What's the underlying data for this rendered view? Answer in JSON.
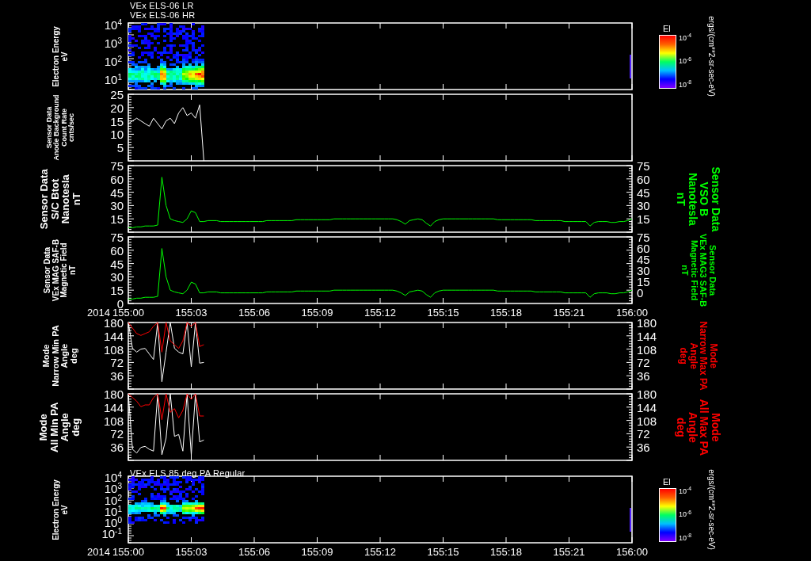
{
  "titles": [
    "VEx ELS-06 LR",
    "VEx ELS-06 HR"
  ],
  "panels": [
    {
      "kind": "spectrogram",
      "left_label": [
        "Electron Energy",
        "eV"
      ],
      "yticks": [
        "10$^{4}$",
        "10$^{3}$",
        "10$^{2}$",
        "10$^{1}$"
      ],
      "colorbar": {
        "label": "El",
        "ticks": [
          "10$^{-4}$",
          "10$^{-6}$",
          "10$^{-8}$"
        ],
        "units": "ergs/(cm**2-sr-sec-eV)"
      }
    },
    {
      "kind": "line",
      "left_label": [
        "Sensor Data",
        "Anode Background",
        "Count Rate",
        "cnts/sec"
      ],
      "chart_data": {
        "type": "line",
        "categories": [
          null,
          null,
          null,
          null,
          null,
          null,
          null,
          null,
          null,
          null,
          null,
          null,
          null,
          null,
          null,
          null,
          null,
          null,
          null
        ],
        "series": [
          {
            "color": "#ffffff",
            "values": [
              14,
              15,
              16,
              15,
              14,
              13,
              16,
              14,
              12,
              15,
              16,
              14,
              18,
              20,
              17,
              18,
              16,
              21,
              0
            ]
          }
        ],
        "ylim": [
          0,
          25
        ],
        "yticks": [
          {
            "value": 5,
            "label": "5"
          },
          {
            "value": 10,
            "label": "10"
          },
          {
            "value": 15,
            "label": "15"
          },
          {
            "value": 20,
            "label": "20"
          },
          {
            "value": 25,
            "label": "25"
          }
        ]
      }
    },
    {
      "kind": "line",
      "left_label": [
        "Sensor Data",
        "S/C Btot",
        "Nanotesla",
        "nT"
      ],
      "right_label": {
        "lines": [
          "Sensor Data",
          "VSO B",
          "Nanotesla",
          "nT"
        ],
        "color": "#00ff00"
      },
      "right_yticks": [
        "75",
        "60",
        "45",
        "30",
        "15"
      ],
      "chart_data": {
        "type": "line",
        "categories": [
          null,
          null,
          null,
          null,
          null,
          null,
          null,
          null,
          null,
          null,
          null,
          null,
          null,
          null,
          null,
          null,
          null,
          null,
          null,
          null,
          null,
          null,
          null,
          null,
          null,
          null,
          null,
          null,
          null,
          null,
          null,
          null,
          null,
          null,
          null,
          null,
          null,
          null,
          null,
          null,
          null,
          null,
          null,
          null,
          null,
          null,
          null,
          null,
          null,
          null,
          null,
          null,
          null,
          null,
          null,
          null,
          null,
          null,
          null,
          null,
          null,
          null,
          null,
          null,
          null,
          null,
          null,
          null,
          null,
          null,
          null,
          null,
          null,
          null,
          null,
          null,
          null,
          null,
          null,
          null,
          null,
          null,
          null,
          null,
          null,
          null,
          null,
          null,
          null,
          null,
          null,
          null,
          null,
          null,
          null,
          null,
          null,
          null,
          null,
          null,
          null,
          null,
          null,
          null,
          null,
          null,
          null,
          null,
          null,
          null,
          null,
          null,
          null,
          null,
          null,
          null,
          null,
          null,
          null,
          null,
          null
        ],
        "series": [
          {
            "color": "#00ff00",
            "values": [
              5,
              5,
              6,
              6,
              7,
              7,
              7,
              8,
              62,
              30,
              15,
              13,
              12,
              11,
              15,
              24,
              22,
              12,
              12,
              13,
              13,
              13,
              12,
              12,
              12,
              12,
              12,
              12,
              12,
              12,
              12,
              12,
              12,
              13,
              13,
              13,
              13,
              13,
              13,
              13,
              14,
              14,
              14,
              14,
              14,
              14,
              14,
              14,
              14,
              15,
              15,
              15,
              15,
              15,
              15,
              15,
              15,
              15,
              15,
              15,
              15,
              15,
              15,
              15,
              14,
              12,
              9,
              13,
              14,
              15,
              14,
              10,
              7,
              12,
              14,
              15,
              15,
              15,
              15,
              15,
              15,
              15,
              15,
              15,
              15,
              15,
              15,
              15,
              14,
              14,
              14,
              14,
              14,
              14,
              14,
              14,
              14,
              13,
              13,
              13,
              13,
              13,
              13,
              13,
              12,
              12,
              12,
              12,
              12,
              12,
              7,
              11,
              12,
              12,
              12,
              11,
              11,
              12,
              12,
              13,
              15
            ]
          }
        ],
        "ylim": [
          0,
          75
        ],
        "yticks": [
          {
            "value": 15,
            "label": "15"
          },
          {
            "value": 30,
            "label": "30"
          },
          {
            "value": 45,
            "label": "45"
          },
          {
            "value": 60,
            "label": "60"
          },
          {
            "value": 75,
            "label": "75"
          }
        ]
      }
    },
    {
      "kind": "line",
      "left_label": [
        "Sensor Data",
        "VEx MAG SAF-B",
        "Magnetic Field",
        "nT"
      ],
      "right_label": {
        "lines": [
          "Sensor Data",
          "VEx MAG3 SAF-B",
          "Magnetic Field",
          "nT"
        ],
        "color": "#00ff00"
      },
      "right_yticks": [
        "75",
        "60",
        "45",
        "30",
        "15",
        "0"
      ],
      "year": "2014",
      "chart_data": {
        "type": "line",
        "categories": [
          "155:00",
          null,
          null,
          null,
          null,
          null,
          null,
          null,
          null,
          null,
          null,
          null,
          null,
          null,
          null,
          "155:03",
          null,
          null,
          null,
          null,
          null,
          null,
          null,
          null,
          null,
          null,
          null,
          null,
          null,
          null,
          "155:06",
          null,
          null,
          null,
          null,
          null,
          null,
          null,
          null,
          null,
          null,
          null,
          null,
          null,
          null,
          "155:09",
          null,
          null,
          null,
          null,
          null,
          null,
          null,
          null,
          null,
          null,
          null,
          null,
          null,
          null,
          "155:12",
          null,
          null,
          null,
          null,
          null,
          null,
          null,
          null,
          null,
          null,
          null,
          null,
          null,
          null,
          "155:15",
          null,
          null,
          null,
          null,
          null,
          null,
          null,
          null,
          null,
          null,
          null,
          null,
          null,
          null,
          "155:18",
          null,
          null,
          null,
          null,
          null,
          null,
          null,
          null,
          null,
          null,
          null,
          null,
          null,
          null,
          "155:21",
          null,
          null,
          null,
          null,
          null,
          null,
          null,
          null,
          null,
          null,
          null,
          null,
          null,
          null,
          "156:00"
        ],
        "series": [
          {
            "color": "#00ff00",
            "values": [
              5,
              5,
              6,
              6,
              7,
              7,
              7,
              8,
              62,
              30,
              15,
              13,
              12,
              11,
              15,
              24,
              22,
              12,
              12,
              13,
              13,
              13,
              12,
              12,
              12,
              12,
              12,
              12,
              12,
              12,
              12,
              12,
              12,
              13,
              13,
              13,
              13,
              13,
              13,
              13,
              14,
              14,
              14,
              14,
              14,
              14,
              14,
              14,
              14,
              15,
              15,
              15,
              15,
              15,
              15,
              15,
              15,
              15,
              15,
              15,
              15,
              15,
              15,
              15,
              14,
              12,
              9,
              13,
              14,
              15,
              14,
              10,
              7,
              12,
              14,
              15,
              15,
              15,
              15,
              15,
              15,
              15,
              15,
              15,
              15,
              15,
              15,
              15,
              14,
              14,
              14,
              14,
              14,
              14,
              14,
              14,
              14,
              13,
              13,
              13,
              13,
              13,
              13,
              13,
              12,
              12,
              12,
              12,
              12,
              12,
              7,
              11,
              12,
              12,
              12,
              11,
              11,
              12,
              12,
              13,
              15
            ]
          }
        ],
        "ylim": [
          0,
          75
        ],
        "yticks": [
          {
            "value": 0,
            "label": "0"
          },
          {
            "value": 15,
            "label": "15"
          },
          {
            "value": 30,
            "label": "30"
          },
          {
            "value": 45,
            "label": "45"
          },
          {
            "value": 60,
            "label": "60"
          },
          {
            "value": 75,
            "label": "75"
          }
        ]
      }
    },
    {
      "kind": "line",
      "left_label": [
        "Mode",
        "Narrow Min PA",
        "Angle",
        "deg"
      ],
      "right_label": {
        "lines": [
          "Mode",
          "Narrow Max PA",
          "Angle",
          "deg"
        ],
        "color": "#ff0000"
      },
      "right_yticks": [
        "180",
        "144",
        "108",
        "72",
        "36"
      ],
      "chart_data": {
        "type": "line",
        "categories": [
          null,
          null,
          null,
          null,
          null,
          null,
          null,
          null,
          null,
          null,
          null,
          null,
          null,
          null,
          null,
          null,
          null,
          null,
          null
        ],
        "series": [
          {
            "color": "#ffffff",
            "values": [
              180,
              110,
              100,
              108,
              110,
              95,
              80,
              180,
              20,
              100,
              180,
              110,
              100,
              95,
              180,
              60,
              180,
              70,
              72
            ]
          },
          {
            "color": "#ff0000",
            "values": [
              180,
              165,
              150,
              145,
              150,
              155,
              170,
              180,
              100,
              180,
              130,
              120,
              110,
              130,
              180,
              170,
              180,
              115,
              120
            ]
          }
        ],
        "ylim": [
          0,
          180
        ],
        "yticks": [
          {
            "value": 36,
            "label": "36"
          },
          {
            "value": 72,
            "label": "72"
          },
          {
            "value": 108,
            "label": "108"
          },
          {
            "value": 144,
            "label": "144"
          },
          {
            "value": 180,
            "label": "180"
          }
        ]
      }
    },
    {
      "kind": "line",
      "left_label": [
        "Mode",
        "All Min PA",
        "Angle",
        "deg"
      ],
      "right_label": {
        "lines": [
          "Mode",
          "All Max PA",
          "Angle",
          "deg"
        ],
        "color": "#ff0000"
      },
      "right_yticks": [
        "180",
        "144",
        "108",
        "72",
        "36"
      ],
      "chart_data": {
        "type": "line",
        "categories": [
          null,
          null,
          null,
          null,
          null,
          null,
          null,
          null,
          null,
          null,
          null,
          null,
          null,
          null,
          null,
          null,
          null,
          null,
          null
        ],
        "series": [
          {
            "color": "#ffffff",
            "values": [
              180,
              30,
              20,
              35,
              38,
              30,
              25,
              180,
              15,
              60,
              180,
              65,
              70,
              25,
              180,
              15,
              180,
              50,
              55
            ]
          },
          {
            "color": "#ff0000",
            "values": [
              180,
              170,
              160,
              145,
              150,
              150,
              170,
              180,
              110,
              180,
              130,
              140,
              115,
              135,
              180,
              165,
              180,
              120,
              120
            ]
          }
        ],
        "ylim": [
          0,
          180
        ],
        "yticks": [
          {
            "value": 36,
            "label": "36"
          },
          {
            "value": 72,
            "label": "72"
          },
          {
            "value": 108,
            "label": "108"
          },
          {
            "value": 144,
            "label": "144"
          },
          {
            "value": 180,
            "label": "180"
          }
        ]
      }
    },
    {
      "kind": "title",
      "text": "VEx ELS 85 deg PA Regular"
    },
    {
      "kind": "spectrogram",
      "left_label": [
        "Electron Energy",
        "eV"
      ],
      "yticks": [
        "10$^{4}$",
        "10$^{3}$",
        "10$^{2}$",
        "10$^{1}$",
        "10$^{0}$",
        "10$^{-1}$"
      ],
      "colorbar": {
        "label": "El",
        "ticks": [
          "10$^{-4}$",
          "10$^{-6}$",
          "10$^{-8}$"
        ],
        "units": "ergs/(cm**2-sr-sec-eV)"
      }
    },
    {
      "kind": "time_axis",
      "year": "2014",
      "ticks": [
        "155:00",
        "155:03",
        "155:06",
        "155:09",
        "155:12",
        "155:15",
        "155:18",
        "155:21",
        "156:00"
      ]
    }
  ]
}
